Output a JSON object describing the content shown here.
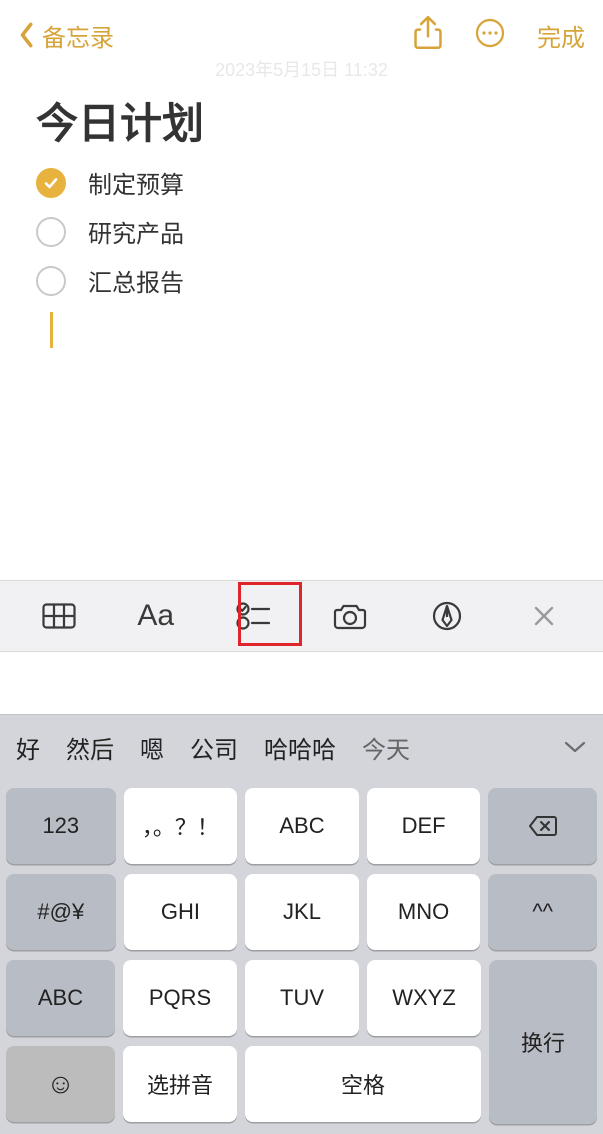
{
  "header": {
    "back_label": "备忘录",
    "done_label": "完成"
  },
  "timestamp": "2023年5月15日 11:32",
  "note": {
    "title": "今日计划",
    "checklist": [
      {
        "text": "制定预算",
        "checked": true
      },
      {
        "text": "研究产品",
        "checked": false
      },
      {
        "text": "汇总报告",
        "checked": false
      }
    ]
  },
  "formatbar": {
    "aa_label": "Aa"
  },
  "keyboard": {
    "suggestions": [
      "好",
      "然后",
      "嗯",
      "公司",
      "哈哈哈",
      "今天"
    ],
    "keys": {
      "r1c1": "123",
      "r1c2": "，。？！",
      "r1c3": "ABC",
      "r1c4": "DEF",
      "r2c1": "#@¥",
      "r2c2": "GHI",
      "r2c3": "JKL",
      "r2c4": "MNO",
      "r2c5": "^^",
      "r3c1": "ABC",
      "r3c2": "PQRS",
      "r3c3": "TUV",
      "r3c4": "WXYZ",
      "r4c2": "选拼音",
      "r4c3": "空格",
      "enter": "换行"
    }
  }
}
